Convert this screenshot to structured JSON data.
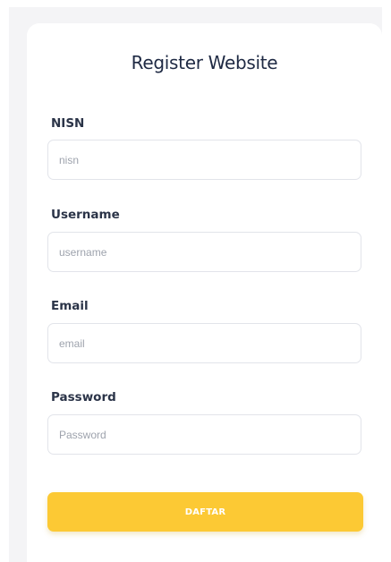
{
  "form": {
    "title": "Register Website",
    "fields": [
      {
        "label": "NISN",
        "placeholder": "nisn",
        "value": ""
      },
      {
        "label": "Username",
        "placeholder": "username",
        "value": ""
      },
      {
        "label": "Email",
        "placeholder": "email",
        "value": ""
      },
      {
        "label": "Password",
        "placeholder": "Password",
        "value": ""
      }
    ],
    "submit_label": "DAFTAR"
  },
  "colors": {
    "accent": "#fcc934",
    "title_text": "#1f2a44",
    "label_text": "#2b3448",
    "input_border": "#e2e4ea",
    "backdrop": "#f4f4f6"
  }
}
